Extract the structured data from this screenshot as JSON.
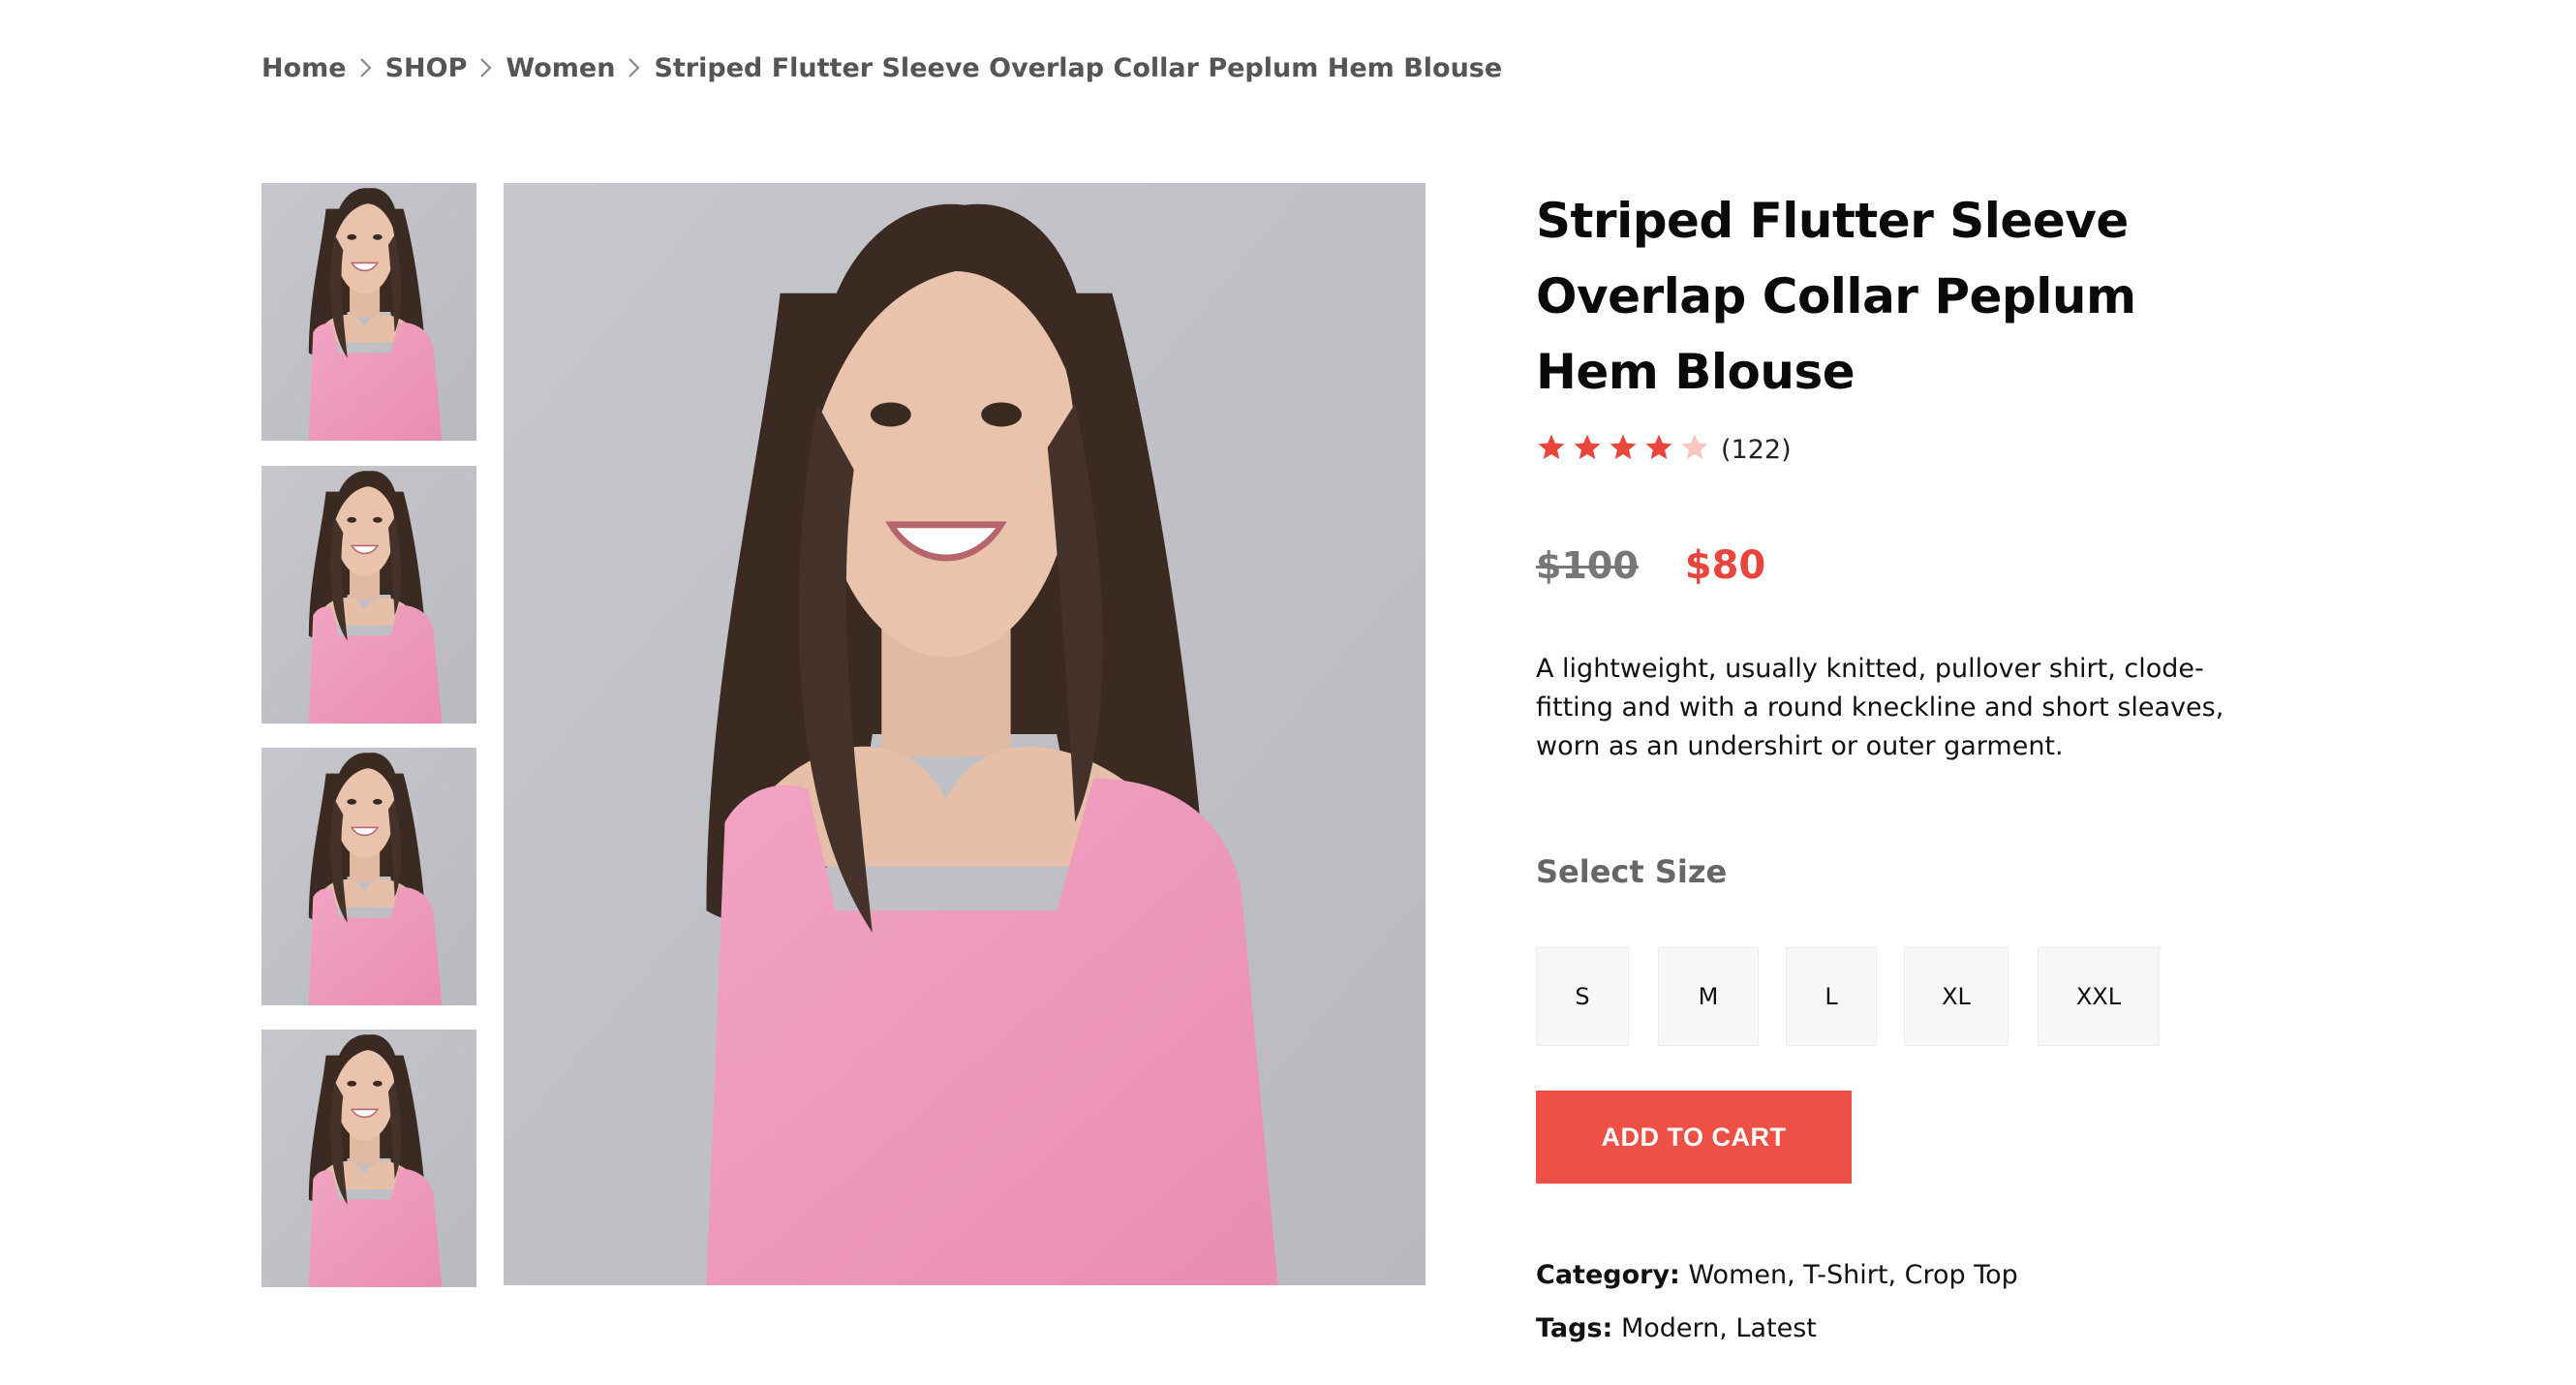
{
  "breadcrumb": {
    "items": [
      "Home",
      "SHOP",
      "Women",
      "Striped Flutter Sleeve Overlap Collar Peplum Hem Blouse"
    ],
    "separator_icon": "chevron-right-icon"
  },
  "gallery": {
    "thumbnail_count": 4,
    "main_image_alt": "Woman wearing pink square-neck top"
  },
  "product": {
    "title": "Striped Flutter Sleeve Overlap Collar Peplum Hem Blouse",
    "rating": {
      "value": 4,
      "max": 5,
      "count_label": "(122)",
      "star_color": "#e8453c",
      "empty_star_color": "#f7c6c1"
    },
    "old_price": "$100",
    "new_price": "$80",
    "description": "A lightweight, usually knitted, pullover shirt, clode-fitting and with a round kneckline and short sleaves, worn as an undershirt or outer garment.",
    "size_heading": "Select Size",
    "sizes": [
      "S",
      "M",
      "L",
      "XL",
      "XXL"
    ],
    "add_to_cart_label": "ADD TO CART",
    "category_label": "Category:",
    "category_value": "Women, T-Shirt, Crop Top",
    "tags_label": "Tags:",
    "tags_value": "Modern, Latest"
  },
  "colors": {
    "accent": "#ee5046",
    "price_red": "#e8453c",
    "text_muted": "#555555"
  }
}
